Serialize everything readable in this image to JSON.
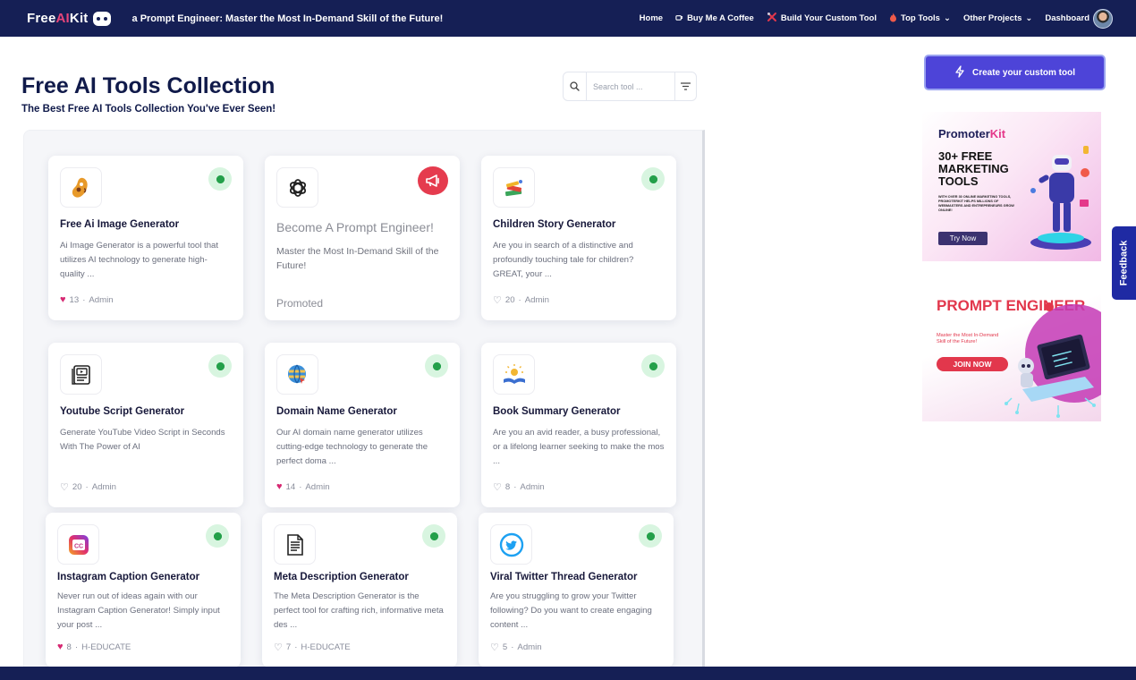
{
  "header": {
    "logo_prefix": "Free",
    "logo_ai": "AI",
    "logo_suffix": "Kit",
    "tagline": "a Prompt Engineer: Master the Most In-Demand Skill of the Future!",
    "nav": [
      {
        "label": "Home",
        "icon": ""
      },
      {
        "label": "Buy Me A Coffee",
        "icon": "coffee-icon"
      },
      {
        "label": "Build Your Custom Tool",
        "icon": "tools-icon"
      },
      {
        "label": "Top Tools",
        "icon": "flame-icon",
        "dropdown": true
      },
      {
        "label": "Other Projects",
        "dropdown": true
      },
      {
        "label": "Dashboard"
      }
    ]
  },
  "page": {
    "title": "Free AI Tools Collection",
    "subtitle": "The Best Free AI Tools Collection You've Ever Seen!"
  },
  "search": {
    "placeholder": "Search tool ..."
  },
  "cards": [
    {
      "title": "Free Ai Image Generator",
      "desc": "Ai Image Generator is a powerful tool that utilizes AI technology to generate high-quality ...",
      "likes": "13",
      "author": "Admin",
      "liked": true,
      "icon": "palette-icon"
    },
    {
      "promoted": true,
      "title": "Become A Prompt Engineer!",
      "desc": "Master the Most In-Demand Skill of the Future!",
      "label": "Promoted",
      "icon": "openai-icon"
    },
    {
      "title": "Children Story Generator",
      "desc": "Are you in search of a distinctive and profoundly touching tale for children? GREAT, your ...",
      "likes": "20",
      "author": "Admin",
      "liked": false,
      "icon": "books-icon"
    },
    {
      "title": "Youtube Script Generator",
      "desc": "Generate YouTube Video Script in Seconds With The Power of AI",
      "likes": "20",
      "author": "Admin",
      "liked": false,
      "icon": "video-script-icon"
    },
    {
      "title": "Domain Name Generator",
      "desc": "Our AI domain name generator utilizes cutting-edge technology to generate the perfect doma ...",
      "likes": "14",
      "author": "Admin",
      "liked": true,
      "icon": "globe-icon"
    },
    {
      "title": "Book Summary Generator",
      "desc": "Are you an avid reader, a busy professional, or a lifelong learner seeking to make the mos ...",
      "likes": "8",
      "author": "Admin",
      "liked": false,
      "icon": "open-book-icon"
    },
    {
      "title": "Instagram Caption Generator",
      "desc": "Never run out of ideas again with our Instagram Caption Generator! Simply input your post ...",
      "likes": "8",
      "author": "H-EDUCATE",
      "liked": true,
      "icon": "instagram-cc-icon"
    },
    {
      "title": "Meta Description Generator",
      "desc": "The Meta Description Generator is the perfect tool for crafting rich, informative meta des ...",
      "likes": "7",
      "author": "H-EDUCATE",
      "liked": false,
      "icon": "document-icon"
    },
    {
      "title": "Viral Twitter Thread Generator",
      "desc": "Are you struggling to grow your Twitter following? Do you want to create engaging content ...",
      "likes": "5",
      "author": "Admin",
      "liked": false,
      "icon": "twitter-icon"
    }
  ],
  "sidebar": {
    "create_button": "Create your custom tool",
    "ad1": {
      "brand_a": "Promoter",
      "brand_b": "Kit",
      "headline": "30+ FREE MARKETING TOOLS",
      "small": "WITH OVER 30 ONLINE MARKETING TOOLS, PROMOTERKIT HELPS MILLIONS OF WEBMASTERS AND ENTREPRENEURS GROW ONLINE!",
      "cta": "Try Now"
    },
    "ad2": {
      "headline": "PROMPT ENGINEER",
      "small": "Master the Most In-Demand Skill of the Future!",
      "cta": "JOIN NOW"
    }
  },
  "feedback": "Feedback",
  "colors": {
    "header_bg": "#151f55",
    "accent": "#4d44d8",
    "check_green": "#24a04a",
    "heart": "#d62872",
    "promo_red": "#e53b4e"
  }
}
